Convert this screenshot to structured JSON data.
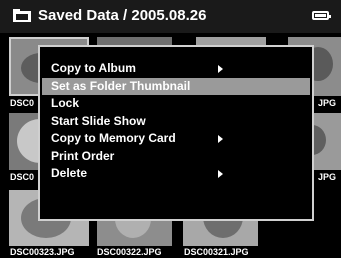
{
  "header": {
    "title": "Saved Data / 2005.08.26",
    "icons": [
      "folder-icon",
      "battery-icon"
    ],
    "battery_level": 1.0
  },
  "thumbnails": {
    "row1_left_label": "DSC0",
    "row1_right_label": "JPG",
    "row2_left_label": "DSC0",
    "row2_right_label": "JPG",
    "row3_labels": [
      "DSC00323.JPG",
      "DSC00322.JPG",
      "DSC00321.JPG"
    ]
  },
  "menu": {
    "items": [
      {
        "label": "Copy to Album",
        "submenu": true
      },
      {
        "label": "Set as Folder Thumbnail",
        "submenu": false,
        "highlighted": true
      },
      {
        "label": "Lock",
        "submenu": false
      },
      {
        "label": "Start Slide Show",
        "submenu": false
      },
      {
        "label": "Copy to Memory Card",
        "submenu": true
      },
      {
        "label": "Print Order",
        "submenu": false
      },
      {
        "label": "Delete",
        "submenu": true
      }
    ],
    "submenu_icon": "chevron-right-icon"
  },
  "colors": {
    "background": "#000000",
    "highlight": "#9a9a9a",
    "text": "#ffffff"
  }
}
